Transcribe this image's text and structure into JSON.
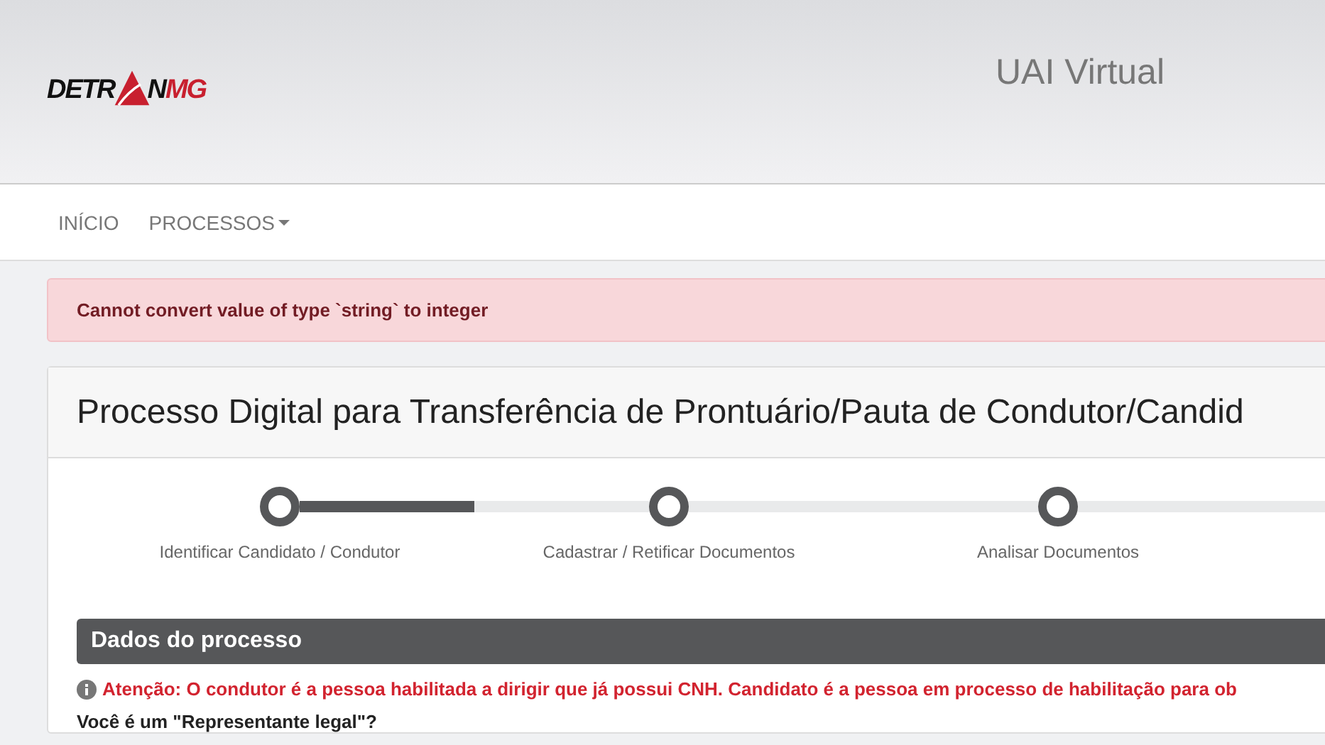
{
  "header": {
    "logo": {
      "left": "DETR",
      "right": "N",
      "suffix": "MG"
    },
    "title": "UAI Virtual"
  },
  "nav": {
    "items": [
      {
        "label": "INÍCIO",
        "dropdown": false
      },
      {
        "label": "PROCESSOS",
        "dropdown": true
      }
    ]
  },
  "alert": {
    "text": "Cannot convert value of type `string` to integer"
  },
  "panel": {
    "title": "Processo Digital para Transferência de Prontuário/Pauta de Condutor/Candid",
    "steps": [
      {
        "label": "Identificar Candidato / Condutor",
        "level": 0.5
      },
      {
        "label": "Cadastrar / Retificar Documentos"
      },
      {
        "label": "Analisar Documentos"
      }
    ],
    "section": {
      "title": "Dados do processo",
      "warning": "Atenção: O condutor é a pessoa habilitada a dirigir que já possui CNH. Candidato é a pessoa em processo de habilitação para ob",
      "question": "Você é um \"Representante legal\"?"
    }
  }
}
